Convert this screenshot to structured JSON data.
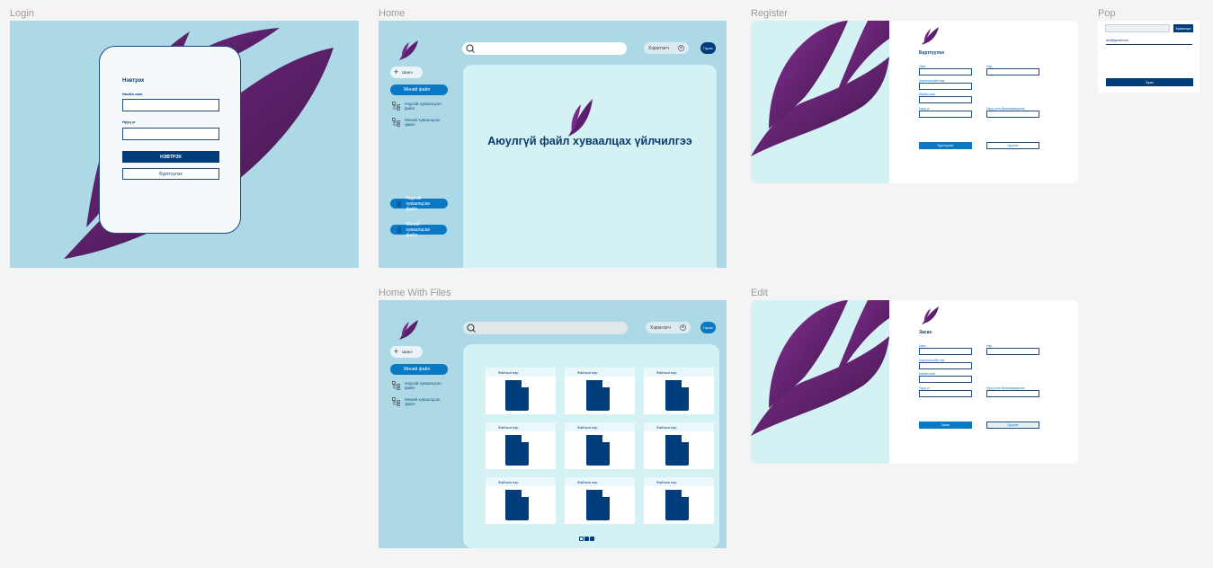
{
  "frames": {
    "login": "Login",
    "home": "Home",
    "register": "Register",
    "pop": "Pop",
    "home_files": "Home With Files",
    "edit": "Edit"
  },
  "colors": {
    "canvas": "#f4f4f4",
    "light_blue": "#add8e6",
    "pale_cyan": "#d4f1f4",
    "navy": "#003d7a",
    "accent": "#0a78c2",
    "feather_dark": "#3a1545",
    "feather_light": "#7a2a8a"
  },
  "login": {
    "title": "Нэвтрэх",
    "username_label": "Имэйл хаяг",
    "password_label": "Нууц үг",
    "login_button": "НЭВТРЭХ",
    "register_button": "Бүртгүүлэх"
  },
  "home": {
    "search_placeholder": "",
    "user_button": "Хэрэглэгч",
    "logout_button": "Гарах",
    "new_button": "Шинэ",
    "nav": [
      "Миний файл",
      "Надтай хуваалцсан файл",
      "Миний хуваалцсан файл"
    ],
    "bottom_nav": [
      "Надтай хуваалцсан файл",
      "Миний хуваалцсан файл"
    ],
    "headline": "Аюулгүй файл хуваалцах үйлчилгээ"
  },
  "home_files": {
    "user_button": "Хэрэглэгч",
    "logout_button": "Гарах",
    "new_button": "Шинэ",
    "nav": [
      "Миний файл",
      "Надтай хуваалцсан файл",
      "Миний хуваалцсан файл"
    ],
    "file_name": "Файлын нэр",
    "files": [
      "Файлын нэр",
      "Файлын нэр",
      "Файлын нэр",
      "Файлын нэр",
      "Файлын нэр",
      "Файлын нэр",
      "Файлын нэр",
      "Файлын нэр",
      "Файлын нэр"
    ]
  },
  "register": {
    "title": "Бүртгүүлэх",
    "fields": [
      "Овог",
      "Нэр",
      "Хэрэглэгчийн нэр",
      "Имэйл хаяг",
      "Нууц үг",
      "Нууц үгээ баталгаажуулах"
    ],
    "submit_button": "Бүртгүүлэх",
    "cancel_button": "Цуцлах"
  },
  "edit": {
    "title": "Засах",
    "fields": [
      "Овог",
      "Нэр",
      "Хэрэглэгчийн нэр",
      "Имэйл хаяг",
      "Нууц үг",
      "Нууц үгээ баталгаажуулах"
    ],
    "submit_button": "Засах",
    "cancel_button": "Цуцлах"
  },
  "pop": {
    "share_button": "Хуваалцах",
    "email_text": "test@gmail.com",
    "close_button": "Гарах"
  }
}
